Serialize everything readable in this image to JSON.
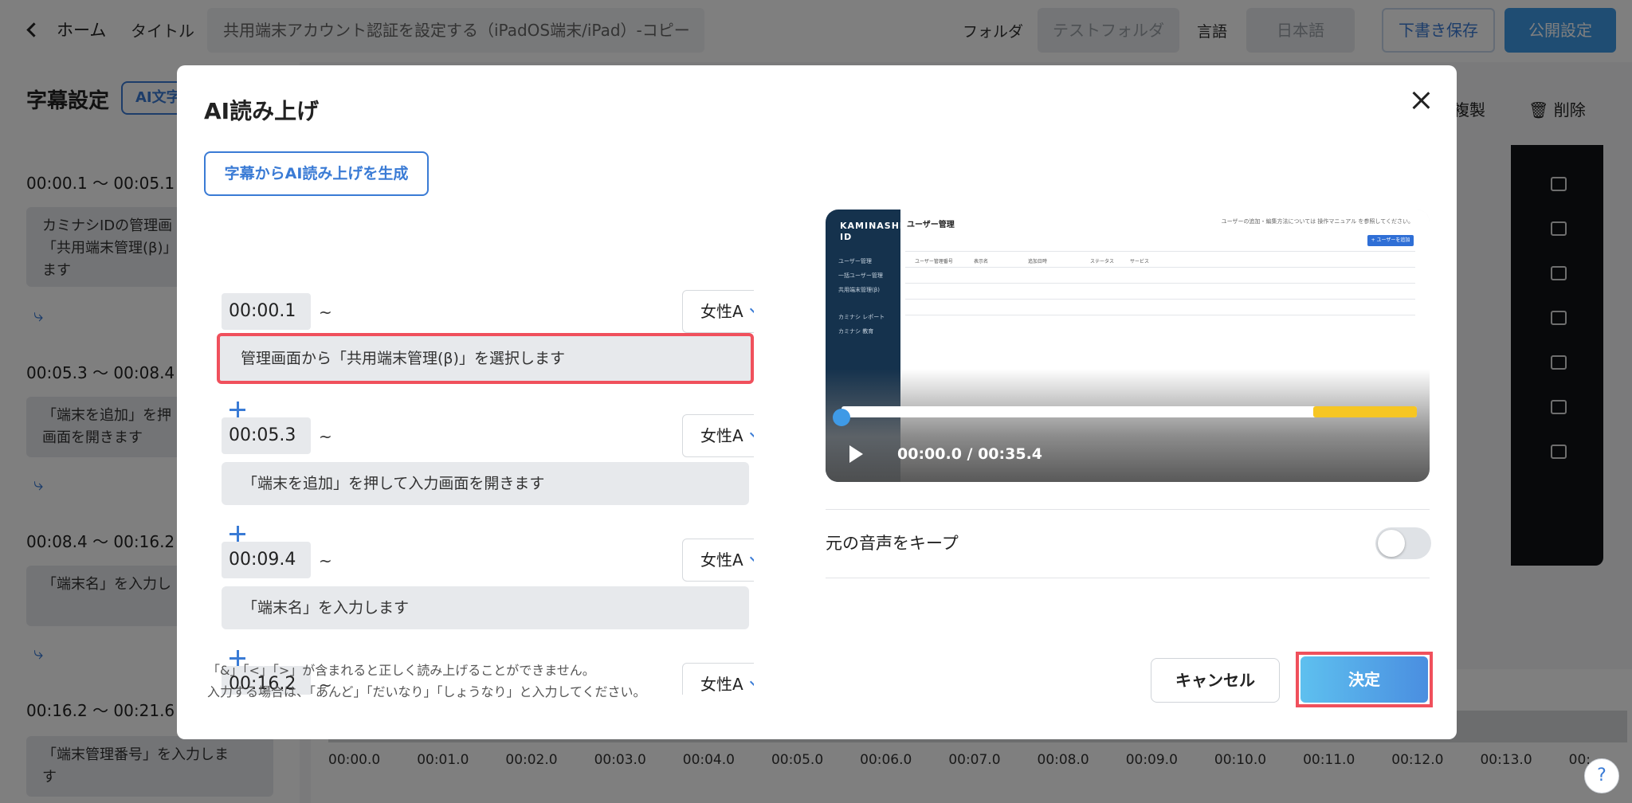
{
  "topbar": {
    "back_label": "ホーム",
    "title_label": "タイトル",
    "title_value": "共用端末アカウント認証を設定する（iPadOS端末/iPad）-コピー",
    "folder_label": "フォルダ",
    "folder_value": "テストフォルダ",
    "language_label": "言語",
    "language_value": "日本語",
    "draft_button": "下書き保存",
    "publish_button": "公開設定"
  },
  "background_panel": {
    "title": "字幕設定",
    "ai_button": "AI文字",
    "entries": [
      {
        "time": "00:00.1 〜 00:05.1",
        "text_line1": "カミナシIDの管理画",
        "text_line2": "「共用端末管理(β)」",
        "text_line3": "ます"
      },
      {
        "time": "00:05.3 〜 00:08.4",
        "text_line1": "「端末を追加」を押",
        "text_line2": "画面を開きます"
      },
      {
        "time": "00:08.4 〜 00:16.2",
        "text_line1": "「端末名」を入力し"
      },
      {
        "time": "00:16.2 〜 00:21.6",
        "text_line1": "「端末管理番号」を入力しま",
        "text_line2": "す"
      }
    ],
    "copy_label": "複製",
    "delete_label": "削除"
  },
  "timeline": {
    "ticks": [
      "00:00.0",
      "00:01.0",
      "00:02.0",
      "00:03.0",
      "00:04.0",
      "00:05.0",
      "00:06.0",
      "00:07.0",
      "00:08.0",
      "00:09.0",
      "00:10.0",
      "00:11.0",
      "00:12.0",
      "00:13.0",
      "00:"
    ]
  },
  "modal": {
    "title": "AI読み上げ",
    "generate_button": "字幕からAI読み上げを生成",
    "items": [
      {
        "time": "00:00.1",
        "tilde": "~",
        "voice": "女性A",
        "text": "管理画面から「共用端末管理(β)」を選択します"
      },
      {
        "time": "00:05.3",
        "tilde": "~",
        "voice": "女性A",
        "text": "「端末を追加」を押して入力画面を開きます"
      },
      {
        "time": "00:09.4",
        "tilde": "~",
        "voice": "女性A",
        "text": "「端末名」を入力します"
      },
      {
        "time": "00:16.2",
        "tilde": "~",
        "voice": "女性A",
        "text": ""
      }
    ],
    "note_line1": "「&」「<」「>」が含まれると正しく読み上げることができません。",
    "note_line2": "入力する場合は、「あんど」「だいなり」「しょうなり」と入力してください。",
    "keep_audio_label": "元の音声をキープ",
    "keep_audio_on": false,
    "cancel_button": "キャンセル",
    "ok_button": "決定"
  },
  "video": {
    "time_display": "00:00.0 / 00:35.4",
    "progress_fraction": 0.0,
    "buffered_start_fraction": 0.82,
    "thumb": {
      "logo_line1": "KAMINASHI",
      "logo_line2": "ID",
      "nav": [
        "ユーザー管理",
        "一括ユーザー管理",
        "共用端末管理(β)",
        "カミナシ レポート",
        "カミナシ 教育"
      ],
      "heading": "ユーザー管理",
      "hint": "ユーザーの追加・編集方法については 操作マニュアル を参照してください。",
      "add_button": "+ ユーザーを追加",
      "columns": [
        "ユーザー管理番号",
        "表示名",
        "追加日時",
        "ステータス",
        "サービス"
      ]
    }
  },
  "help_label": "?",
  "colors": {
    "accent": "#3a7bd5",
    "highlight": "#f0505c",
    "buffer": "#f6c623"
  }
}
